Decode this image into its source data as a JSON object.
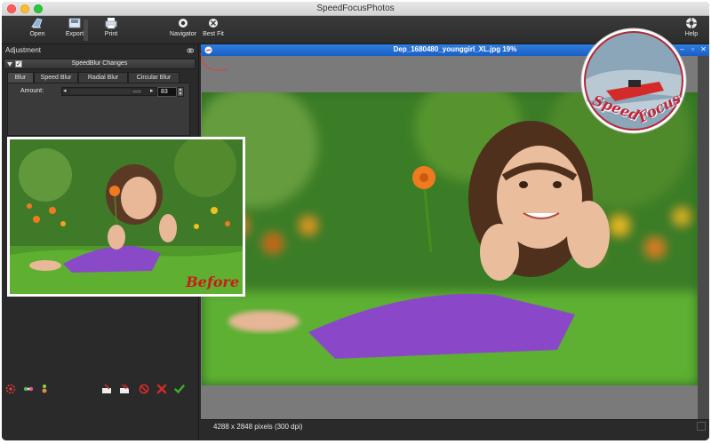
{
  "window": {
    "title": "SpeedFocusPhotos"
  },
  "toolbar": {
    "open_label": "Open",
    "export_label": "Export",
    "print_label": "Print",
    "navigator_label": "Navigator",
    "best_fit_label": "Best Fit",
    "help_label": "Help"
  },
  "panel": {
    "header": "Adjustment",
    "section_title": "SpeedBlur Changes",
    "tabs": [
      "Blur",
      "Speed Blur",
      "Radial Blur",
      "Circular Blur"
    ],
    "active_tab": "Blur",
    "amount_label": "Amount:",
    "amount_value": "83",
    "amount_fraction": 0.83
  },
  "before": {
    "label": "Before"
  },
  "document": {
    "title": "Dep_1680480_younggirl_XL.jpg 19%"
  },
  "status": {
    "info": "4288 x 2848 pixels (300 dpi)"
  },
  "logo": {
    "line1": "Speed",
    "line2": "Focus"
  },
  "colors": {
    "accent": "#1a6fd8",
    "before_text": "#c91c1c",
    "apply_check": "#3fae2a",
    "cancel_x": "#d42a2a"
  }
}
